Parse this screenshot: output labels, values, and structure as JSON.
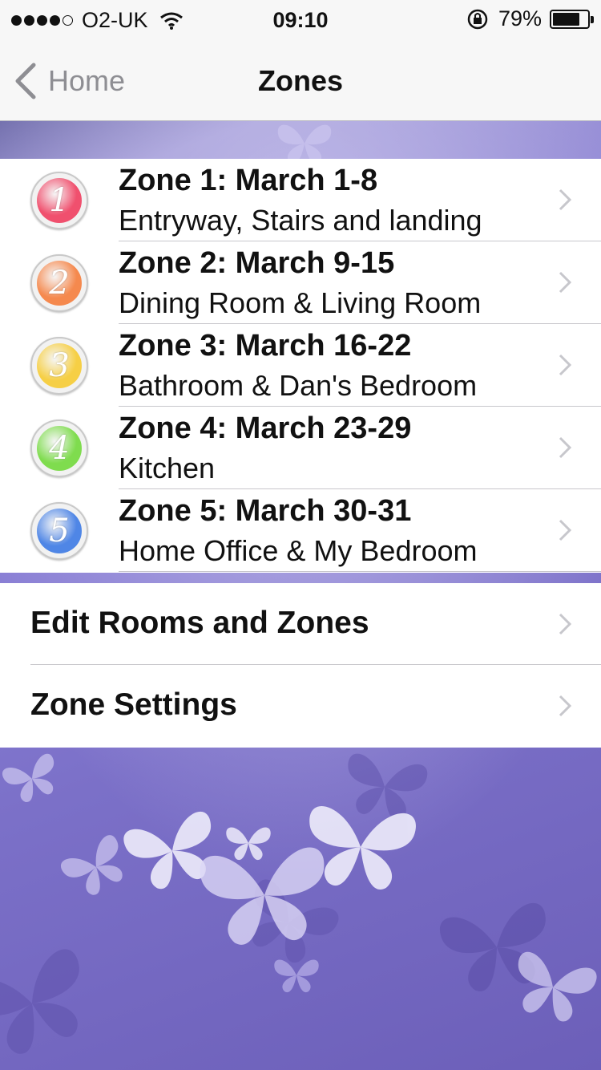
{
  "status_bar": {
    "carrier": "O2-UK",
    "time": "09:10",
    "battery": "79%",
    "battery_level": 0.79
  },
  "nav": {
    "back_label": "Home",
    "title": "Zones"
  },
  "zones": [
    {
      "number": "1",
      "title": "Zone 1: March 1-8",
      "subtitle": "Entryway, Stairs and landing",
      "color": "#f0506e"
    },
    {
      "number": "2",
      "title": "Zone 2: March 9-15",
      "subtitle": "Dining Room & Living Room",
      "color": "#f5894e"
    },
    {
      "number": "3",
      "title": "Zone 3: March 16-22",
      "subtitle": "Bathroom &  Dan's Bedroom",
      "color": "#f6cf45"
    },
    {
      "number": "4",
      "title": "Zone 4: March 23-29",
      "subtitle": "Kitchen",
      "color": "#7fdc4e"
    },
    {
      "number": "5",
      "title": "Zone 5: March 30-31",
      "subtitle": "Home Office & My Bedroom",
      "color": "#4f86e6"
    }
  ],
  "settings": {
    "edit_label": "Edit Rooms and Zones",
    "zone_settings_label": "Zone Settings"
  },
  "colors": {
    "background": "#7a6fc7",
    "chevron": "#c7c7cc",
    "back_tint": "#8e8e93"
  }
}
